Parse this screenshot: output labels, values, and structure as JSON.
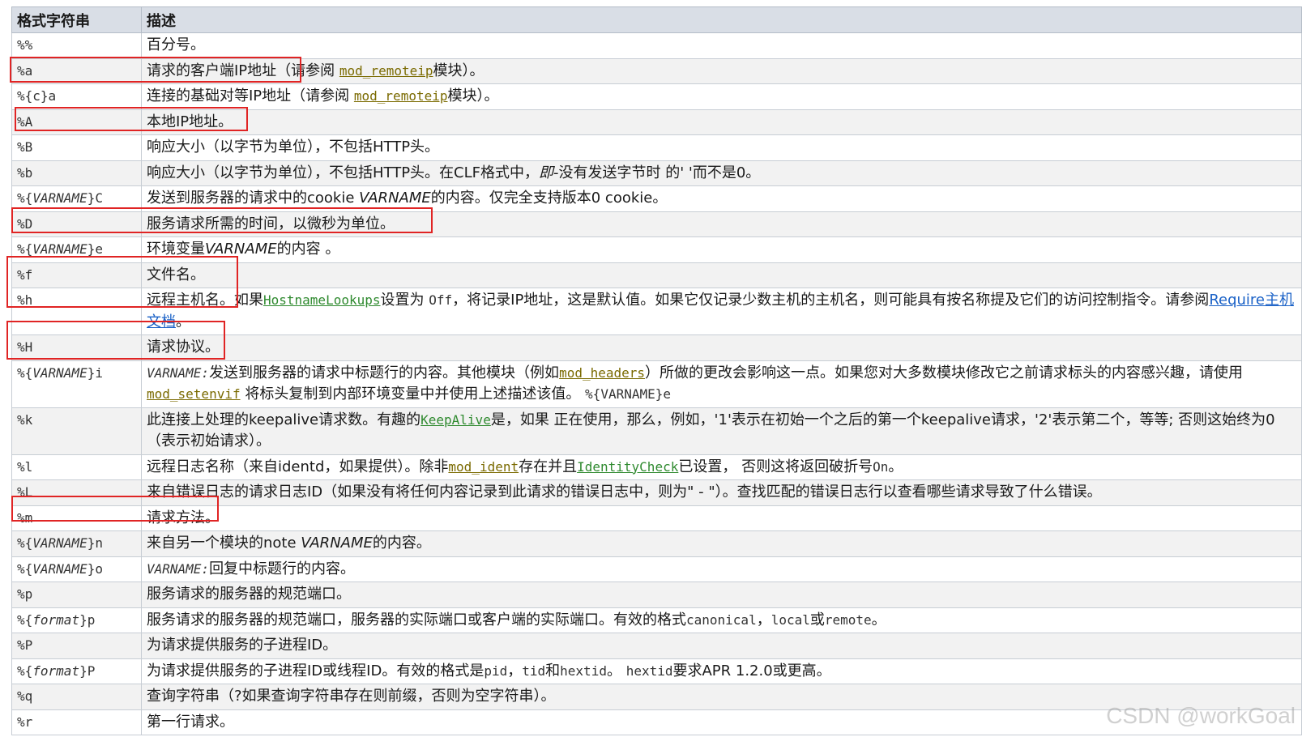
{
  "table": {
    "headers": [
      "格式字符串",
      "描述"
    ],
    "rows": [
      {
        "fmt": "%%",
        "desc": [
          "百分号。"
        ]
      },
      {
        "fmt": "%a",
        "desc": [
          "请求的客户端IP地址",
          "（请参阅 ",
          "mod_remoteip",
          "模块）。"
        ]
      },
      {
        "fmt": "%{c}a",
        "desc": [
          "连接的基础对等IP地址（请参阅 ",
          "mod_remoteip",
          "模块）。"
        ]
      },
      {
        "fmt": "%A",
        "desc": [
          "本地IP地址。"
        ]
      },
      {
        "fmt": "%B",
        "desc": [
          "响应大小（以字节为单位），不包括HTTP头。"
        ]
      },
      {
        "fmt": "%b",
        "desc": [
          "响应大小（以字节为单位），不包括HTTP头。在CLF格式中，",
          "即",
          "-没有发送字节时 的' '而不是0。"
        ]
      },
      {
        "fmt": "%{VARNAME}C",
        "desc": [
          "发送到服务器的请求中的cookie ",
          "VARNAME",
          "的内容。仅完全支持版本0 cookie。"
        ]
      },
      {
        "fmt": "%D",
        "desc": [
          "服务请求所需的时间，以微秒为单位。"
        ]
      },
      {
        "fmt": "%{VARNAME}e",
        "desc": [
          "环境变量",
          "VARNAME",
          "的内容 。"
        ]
      },
      {
        "fmt": "%f",
        "desc": [
          "文件名。"
        ]
      },
      {
        "fmt": "%h",
        "desc": [
          "远程主机名。",
          "如果",
          "HostnameLookups",
          "设置为 ",
          "Off",
          "，将记录IP地址，这是默认值。如果它仅记录少数主机的主机名，则可能具有按名称提及它们的访问控制指令。请参阅",
          "Require主机文档",
          "。"
        ]
      },
      {
        "fmt": "%H",
        "desc": [
          "请求协议。"
        ]
      },
      {
        "fmt": "%{VARNAME}i",
        "desc": [
          "VARNAME:",
          "发送到服务器的请求中标题行的内容。其他模块（例如",
          "mod_headers",
          "）所做的更改会影响这一点。如果您对大多数模块修改它之前请求标头的内容感兴趣，请使用",
          "mod_setenvif",
          " 将标头复制到内部环境变量中并使用上述描述该值。 ",
          "%{VARNAME}e"
        ]
      },
      {
        "fmt": "%k",
        "desc": [
          "此连接上处理的keepalive请求数。有趣的",
          "KeepAlive",
          "是，如果 正在使用，那么，例如，'1'表示在初始一个之后的第一个keepalive请求，'2'表示第二个，等等; 否则这始终为0（表示初始请求）。"
        ]
      },
      {
        "fmt": "%l",
        "desc": [
          "远程日志名称（来自identd，如果提供）。除非",
          "mod_ident",
          "存在并且",
          "IdentityCheck",
          "已设置， 否则这将返回破折号",
          "On",
          "。"
        ]
      },
      {
        "fmt": "%L",
        "desc": [
          "来自错误日志的请求日志ID（如果没有将任何内容记录到此请求的错误日志中，则为\" - \"）。查找匹配的错误日志行以查看哪些请求导致了什么错误。"
        ]
      },
      {
        "fmt": "%m",
        "desc": [
          "请求方法。"
        ]
      },
      {
        "fmt": "%{VARNAME}n",
        "desc": [
          "来自另一个模块的note ",
          "VARNAME",
          "的内容。"
        ]
      },
      {
        "fmt": "%{VARNAME}o",
        "desc": [
          "VARNAME:",
          "回复中标题行的内容。"
        ]
      },
      {
        "fmt": "%p",
        "desc": [
          "服务请求的服务器的规范端口。"
        ]
      },
      {
        "fmt": "%{format}p",
        "desc": [
          "服务请求的服务器的规范端口，服务器的实际端口或客户端的实际端口。有效的格式",
          "canonical",
          "，",
          "local",
          "或",
          "remote",
          "。"
        ]
      },
      {
        "fmt": "%P",
        "desc": [
          "为请求提供服务的子进程ID。"
        ]
      },
      {
        "fmt": "%{format}P",
        "desc": [
          "为请求提供服务的子进程ID或线程ID。有效的格式是",
          "pid",
          "，",
          "tid",
          "和",
          "hextid",
          "。 ",
          "hextid",
          "要求APR 1.2.0或更高。"
        ]
      },
      {
        "fmt": "%q",
        "desc": [
          "查询字符串（?如果查询字符串存在则前缀，否则为空字符串）。"
        ]
      },
      {
        "fmt": "%r",
        "desc": [
          "第一行请求。"
        ]
      }
    ]
  },
  "watermark": "CSDN @workGoal",
  "colors": {
    "highlight": "#e02424",
    "header_bg": "#d9dee6",
    "link": "#7a6a00",
    "link_green": "#2f8a2f",
    "link_blue": "#1b62c7"
  }
}
